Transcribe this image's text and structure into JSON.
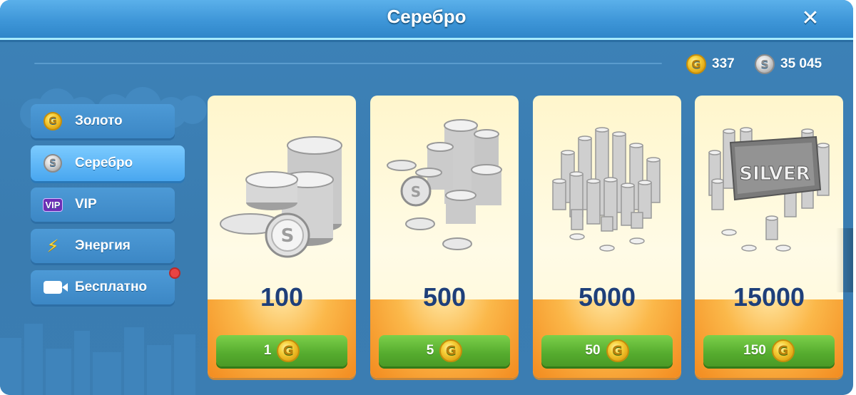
{
  "header": {
    "title": "Серебро",
    "close_icon": "close-icon"
  },
  "currency": {
    "gold": {
      "icon": "gold-coin-icon",
      "value": "337"
    },
    "silver": {
      "icon": "silver-coin-icon",
      "value": "35 045"
    }
  },
  "sidebar": {
    "items": [
      {
        "label": "Золото",
        "icon": "gold-coin-icon",
        "active": false
      },
      {
        "label": "Серебро",
        "icon": "silver-coin-icon",
        "active": true
      },
      {
        "label": "VIP",
        "icon": "vip-icon",
        "active": false
      },
      {
        "label": "Энергия",
        "icon": "lightning-icon",
        "active": false
      },
      {
        "label": "Бесплатно",
        "icon": "video-camera-icon",
        "active": false,
        "notification": true
      }
    ]
  },
  "offers": [
    {
      "amount": "100",
      "price": "1",
      "price_icon": "gold-coin-icon",
      "art": "silver-coin-stacks"
    },
    {
      "amount": "500",
      "price": "5",
      "price_icon": "gold-coin-icon",
      "art": "silver-coin-stacks"
    },
    {
      "amount": "5000",
      "price": "50",
      "price_icon": "gold-coin-icon",
      "art": "silver-coin-piles"
    },
    {
      "amount": "15000",
      "price": "150",
      "price_icon": "gold-coin-icon",
      "art": "silver-bar-with-coins",
      "art_text": "SILVER"
    }
  ],
  "colors": {
    "title_bar": "#3e96d8",
    "background": "#3a7cb0",
    "button_green": "#55ab2e",
    "amount_text": "#1e3f7a",
    "card_orange": "#f38b1f"
  }
}
